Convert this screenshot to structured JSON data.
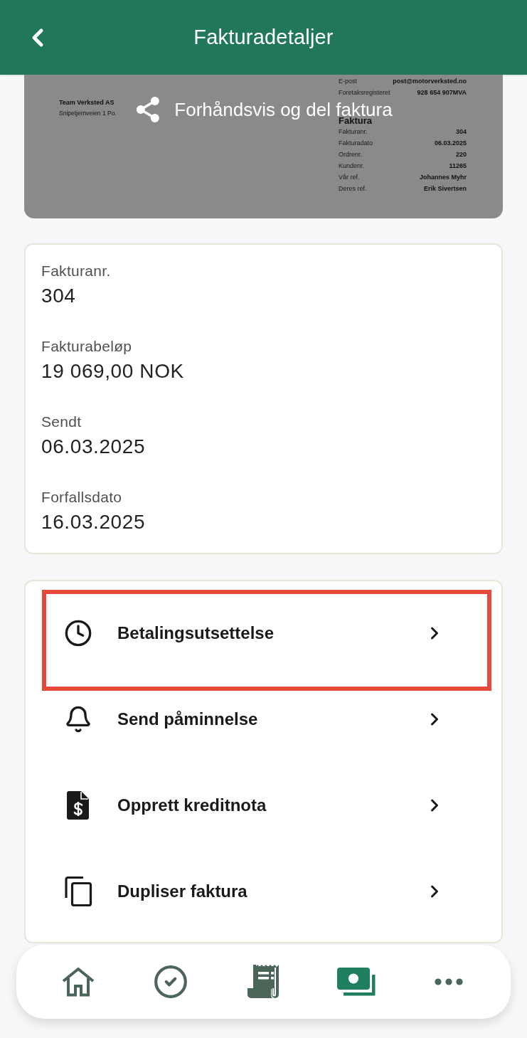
{
  "header": {
    "title": "Fakturadetaljer"
  },
  "invoice_preview": {
    "contact_rows": [
      {
        "label": "E-post",
        "value": "post@motorverksted.no"
      },
      {
        "label": "Foretaksregisteret",
        "value": "928 654 907MVA"
      }
    ],
    "company": {
      "name": "Team Verksted AS",
      "address": "Snipetjernveien 1 Po."
    },
    "heading": "Faktura",
    "detail_rows": [
      {
        "label": "Fakturanr.",
        "value": "304"
      },
      {
        "label": "Fakturadato",
        "value": "06.03.2025"
      },
      {
        "label": "Ordrenr.",
        "value": "220"
      },
      {
        "label": "Kundenr.",
        "value": "11265"
      },
      {
        "label": "Vår ref.",
        "value": "Johannes Myhr"
      },
      {
        "label": "Deres ref.",
        "value": "Erik Sivertsen"
      }
    ],
    "action_label": "Forhåndsvis og del faktura"
  },
  "details": [
    {
      "label": "Fakturanr.",
      "value": "304"
    },
    {
      "label": "Fakturabeløp",
      "value": "19 069,00 NOK"
    },
    {
      "label": "Sendt",
      "value": "06.03.2025"
    },
    {
      "label": "Forfallsdato",
      "value": "16.03.2025"
    }
  ],
  "actions": [
    {
      "kind": "clock",
      "label": "Betalingsutsettelse",
      "highlighted": true
    },
    {
      "kind": "bell",
      "label": "Send påminnelse",
      "highlighted": false
    },
    {
      "kind": "credit-note",
      "label": "Opprett kreditnota",
      "highlighted": false
    },
    {
      "kind": "copy",
      "label": "Dupliser faktura",
      "highlighted": false
    }
  ],
  "bottom_nav": [
    {
      "kind": "home",
      "selected": false
    },
    {
      "kind": "check",
      "selected": false
    },
    {
      "kind": "receipt",
      "selected": false
    },
    {
      "kind": "money",
      "selected": true
    },
    {
      "kind": "more",
      "selected": false
    }
  ]
}
